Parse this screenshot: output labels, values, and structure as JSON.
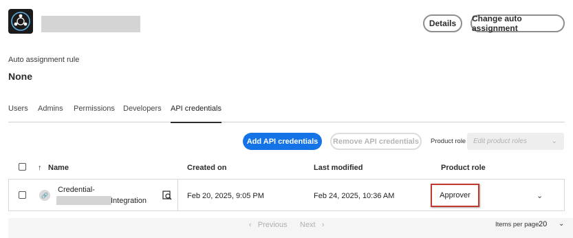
{
  "header": {
    "details_label": "Details",
    "change_label": "Change auto assignment"
  },
  "rule": {
    "label": "Auto assignment rule",
    "value": "None"
  },
  "tabs": [
    {
      "label": "Users"
    },
    {
      "label": "Admins"
    },
    {
      "label": "Permissions"
    },
    {
      "label": "Developers"
    },
    {
      "label": "API credentials",
      "active": true
    }
  ],
  "toolbar": {
    "add_label": "Add API credentials",
    "remove_label": "Remove API credentials",
    "product_role_label": "Product role",
    "product_role_placeholder": "Edit product roles"
  },
  "table": {
    "columns": [
      "Name",
      "Created on",
      "Last modified",
      "Product role"
    ],
    "sort_indicator": "↑",
    "rows": [
      {
        "name_line1": "Credential-",
        "name_line2": "Integration",
        "created": "Feb 20, 2025, 9:05 PM",
        "modified": "Feb 24, 2025, 10:36 AM",
        "role": "Approver"
      }
    ]
  },
  "pagination": {
    "previous_label": "Previous",
    "next_label": "Next",
    "items_per_page_label": "Items per page",
    "items_per_page_value": "20"
  },
  "colors": {
    "accent": "#1473e6",
    "highlight": "#c0392b"
  },
  "icons": {
    "logo": "network-nodes-icon",
    "credential": "link-icon",
    "search_doc": "search-document-icon",
    "expand": "chevron-down-icon"
  }
}
